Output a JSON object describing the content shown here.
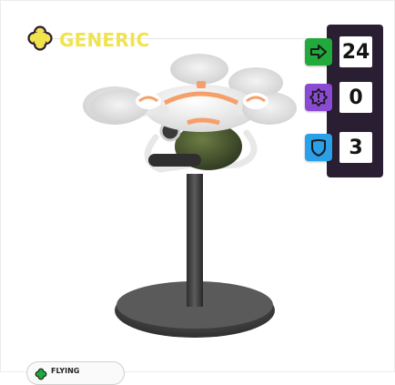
{
  "card": {
    "tag": {
      "label": "GENERIC",
      "icon": "clover-icon",
      "color": "#f1e34e"
    },
    "stats": [
      {
        "icon": "arrow-right-icon",
        "value": "24",
        "color": "#1faa3b"
      },
      {
        "icon": "alert-badge-icon",
        "value": "0",
        "color": "#8a4ad3"
      },
      {
        "icon": "shield-icon",
        "value": "3",
        "color": "#2aa0e8"
      }
    ],
    "type": {
      "label": "FLYING",
      "icon": "clover-icon"
    },
    "image": {
      "subject": "white drone on display stand"
    }
  }
}
